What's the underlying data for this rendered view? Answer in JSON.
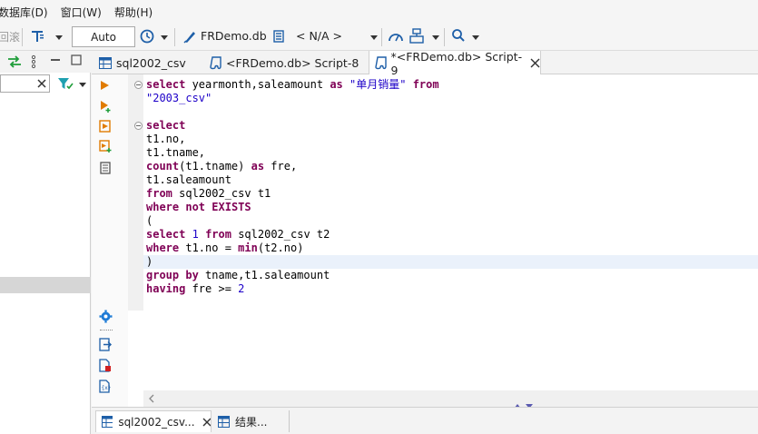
{
  "menu": {
    "items": [
      "数据库(D)",
      "窗口(W)",
      "帮助(H)"
    ]
  },
  "toolbar": {
    "rollback_label": "回滚",
    "transaction_mode": "Auto",
    "datasource": "FRDemo.db",
    "schema": "< N/A >"
  },
  "editor_tabs": [
    {
      "label": "sql2002_csv",
      "active": false
    },
    {
      "label": "<FRDemo.db> Script-8",
      "active": false
    },
    {
      "label": "*<FRDemo.db> Script-9",
      "active": true
    }
  ],
  "code": {
    "lines": [
      "select yearmonth,saleamount as \"单月销量\" from",
      "\"2003_csv\"",
      "",
      "select",
      "t1.no,",
      "t1.tname,",
      "count(t1.tname) as fre,",
      "t1.saleamount",
      "from sql2002_csv t1",
      "where not EXISTS",
      "(",
      "select 1 from sql2002_csv t2",
      "where t1.no = min(t2.no)",
      ")",
      "group by tname,t1.saleamount",
      "having fre >= 2"
    ],
    "highlighted_line": 13
  },
  "bottom_tabs": [
    {
      "label": "sql2002_csv...",
      "active": true
    },
    {
      "label": "结果...",
      "active": false
    }
  ],
  "colors": {
    "keyword": "#7f0055",
    "string": "#1d00c8",
    "accent_blue": "#1e7bd6",
    "run_orange": "#e07b00"
  }
}
